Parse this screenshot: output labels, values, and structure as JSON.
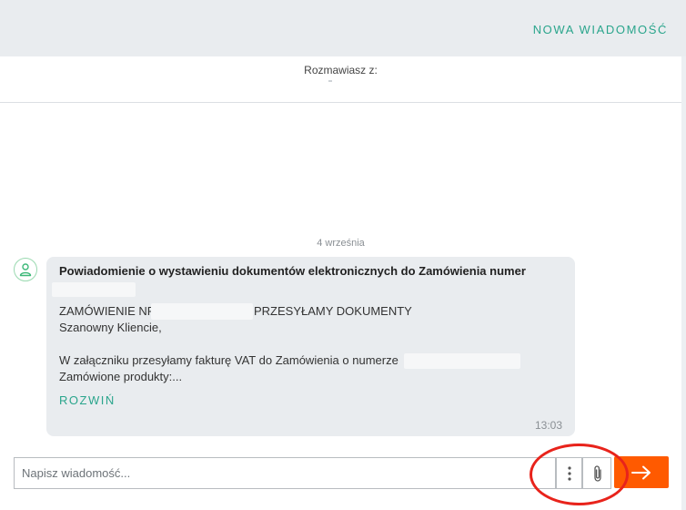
{
  "header": {
    "new_message_label": "NOWA WIADOMOŚĆ"
  },
  "conversation": {
    "with_label": "Rozmawiasz z:"
  },
  "thread": {
    "date_label": "4 września",
    "message": {
      "title": "Powiadomienie o wystawieniu dokumentów elektronicznych do Zamówienia numer",
      "line_order_prefix": "ZAMÓWIENIE NR",
      "line_order_suffix": "PRZESYŁAMY DOKUMENTY",
      "line_greeting": "Szanowny Kliencie,",
      "line_attachment": "W załączniku przesyłamy fakturę VAT do Zamówienia o numerze",
      "line_products": "Zamówione produkty:...",
      "expand_label": "ROZWIŃ",
      "time": "13:03"
    }
  },
  "composer": {
    "placeholder": "Napisz wiadomość...",
    "value": ""
  },
  "icons": {
    "avatar": "user-icon",
    "more": "vertical-dots-icon",
    "attach": "paperclip-icon",
    "send": "arrow-right-icon"
  },
  "colors": {
    "accent_green": "#2aa58c",
    "send_orange": "#ff5a00",
    "annotation_red": "#e8231b",
    "bubble_bg": "#e9ecef"
  }
}
